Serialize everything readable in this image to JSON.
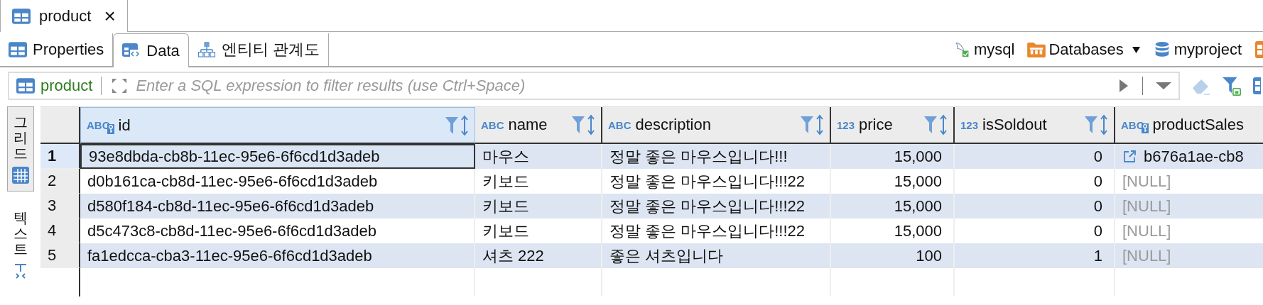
{
  "editor_tab": {
    "title": "product",
    "close": "×"
  },
  "sub_tabs": [
    {
      "label": "Properties",
      "kind": "table",
      "selected": false
    },
    {
      "label": "Data",
      "kind": "data",
      "selected": true
    },
    {
      "label": "엔티티 관계도",
      "kind": "diagram",
      "selected": false
    }
  ],
  "toolbar": {
    "connection": "mysql",
    "folder": "Databases",
    "database": "myproject"
  },
  "filter": {
    "table": "product",
    "placeholder": "Enter a SQL expression to filter results (use Ctrl+Space)"
  },
  "side_tabs": [
    {
      "label": "그리드",
      "kind": "grid",
      "selected": true
    },
    {
      "label": "텍스트",
      "kind": "text",
      "selected": false
    }
  ],
  "table": {
    "columns": [
      {
        "name": "id",
        "type": "ABC",
        "key": true,
        "numeric": false,
        "selected": true
      },
      {
        "name": "name",
        "type": "ABC",
        "key": false,
        "numeric": false,
        "selected": false
      },
      {
        "name": "description",
        "type": "ABC",
        "key": false,
        "numeric": false,
        "selected": false
      },
      {
        "name": "price",
        "type": "123",
        "key": false,
        "numeric": true,
        "selected": false
      },
      {
        "name": "isSoldout",
        "type": "123",
        "key": false,
        "numeric": true,
        "selected": false
      },
      {
        "name": "productSales",
        "type": "ABC",
        "key": true,
        "numeric": false,
        "selected": false
      }
    ],
    "rows": [
      {
        "number": "1",
        "selected": true,
        "cells": [
          {
            "text": "93e8dbda-cb8b-11ec-95e6-6f6cd1d3adeb",
            "kind": "value"
          },
          {
            "text": "마우스",
            "kind": "value"
          },
          {
            "text": "정말 좋은 마우스입니다!!!",
            "kind": "value"
          },
          {
            "text": "15,000",
            "kind": "value"
          },
          {
            "text": "0",
            "kind": "value"
          },
          {
            "text": "b676a1ae-cb8",
            "kind": "link"
          }
        ]
      },
      {
        "number": "2",
        "selected": false,
        "cells": [
          {
            "text": "d0b161ca-cb8d-11ec-95e6-6f6cd1d3adeb",
            "kind": "value"
          },
          {
            "text": "키보드",
            "kind": "value"
          },
          {
            "text": "정말 좋은 마우스입니다!!!22",
            "kind": "value"
          },
          {
            "text": "15,000",
            "kind": "value"
          },
          {
            "text": "0",
            "kind": "value"
          },
          {
            "text": "[NULL]",
            "kind": "null"
          }
        ]
      },
      {
        "number": "3",
        "selected": false,
        "cells": [
          {
            "text": "d580f184-cb8d-11ec-95e6-6f6cd1d3adeb",
            "kind": "value"
          },
          {
            "text": "키보드",
            "kind": "value"
          },
          {
            "text": "정말 좋은 마우스입니다!!!22",
            "kind": "value"
          },
          {
            "text": "15,000",
            "kind": "value"
          },
          {
            "text": "0",
            "kind": "value"
          },
          {
            "text": "[NULL]",
            "kind": "null"
          }
        ]
      },
      {
        "number": "4",
        "selected": false,
        "cells": [
          {
            "text": "d5c473c8-cb8d-11ec-95e6-6f6cd1d3adeb",
            "kind": "value"
          },
          {
            "text": "키보드",
            "kind": "value"
          },
          {
            "text": "정말 좋은 마우스입니다!!!22",
            "kind": "value"
          },
          {
            "text": "15,000",
            "kind": "value"
          },
          {
            "text": "0",
            "kind": "value"
          },
          {
            "text": "[NULL]",
            "kind": "null"
          }
        ]
      },
      {
        "number": "5",
        "selected": false,
        "cells": [
          {
            "text": "fa1edcca-cba3-11ec-95e6-6f6cd1d3adeb",
            "kind": "value"
          },
          {
            "text": "셔츠 222",
            "kind": "value"
          },
          {
            "text": " 좋은 셔츠입니다",
            "kind": "value"
          },
          {
            "text": "100",
            "kind": "value"
          },
          {
            "text": "1",
            "kind": "value"
          },
          {
            "text": "[NULL]",
            "kind": "null"
          }
        ]
      }
    ]
  }
}
